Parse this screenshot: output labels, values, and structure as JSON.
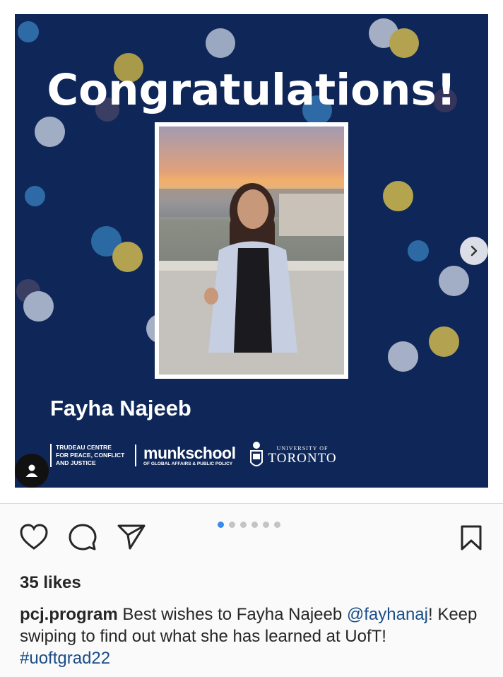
{
  "post": {
    "headline": "Congratulations!",
    "person_name": "Fayha Najeeb",
    "logos": {
      "trudeau_line1": "TRUDEAU CENTRE",
      "trudeau_line2": "FOR PEACE, CONFLICT",
      "trudeau_line3": "AND JUSTICE",
      "munk_main": "munkschool",
      "munk_sub": "OF GLOBAL AFFAIRS & PUBLIC POLICY",
      "uoft_small": "UNIVERSITY OF",
      "uoft_big": "TORONTO"
    },
    "colors": {
      "background": "#0f2758",
      "dot_blue": "#2f6aa6",
      "dot_gold": "#b8a44a",
      "dot_gray": "#a9b6cc"
    }
  },
  "controls": {
    "next_icon": "chevron-right-icon",
    "avatar_icon": "user-icon"
  },
  "carousel": {
    "total": 6,
    "active": 1
  },
  "actions": {
    "like_icon": "heart-icon",
    "comment_icon": "comment-icon",
    "share_icon": "send-icon",
    "save_icon": "bookmark-icon"
  },
  "likes": "35 likes",
  "caption": {
    "username": "pcj.program",
    "text_before": " Best wishes to Fayha Najeeb ",
    "mention": "@fayhanaj",
    "text_after": "! Keep swiping to find out what she has learned at UofT!",
    "hashtag": "#uoftgrad22"
  }
}
